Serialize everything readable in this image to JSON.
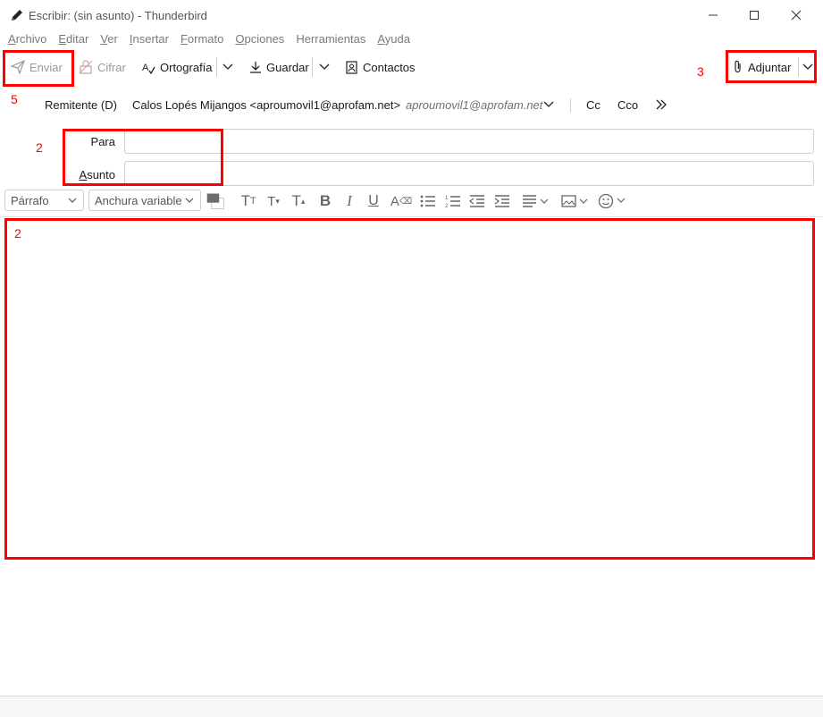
{
  "window": {
    "title": "Escribir: (sin asunto) - Thunderbird"
  },
  "menu": {
    "items": [
      {
        "label": "Archivo",
        "accel": "A",
        "rest": "rchivo"
      },
      {
        "label": "Editar",
        "accel": "E",
        "rest": "ditar"
      },
      {
        "label": "Ver",
        "accel": "V",
        "rest": "er"
      },
      {
        "label": "Insertar",
        "accel": "I",
        "rest": "nsertar"
      },
      {
        "label": "Formato",
        "accel": "F",
        "rest": "ormato"
      },
      {
        "label": "Opciones",
        "accel": "O",
        "rest": "pciones"
      },
      {
        "label": "Herramientas",
        "accel": "",
        "rest": "Herramientas"
      },
      {
        "label": "Ayuda",
        "accel": "A",
        "rest": "yuda"
      }
    ]
  },
  "toolbar": {
    "send_label": "Enviar",
    "encrypt_label": "Cifrar",
    "spelling_label": "Ortografía",
    "save_label": "Guardar",
    "contacts_label": "Contactos",
    "attach_label": "Adjuntar"
  },
  "header": {
    "from_label": "Remitente (D)",
    "from_value": "Calos Lopés Mijangos <aproumovil1@aprofam.net>",
    "from_identity": "aproumovil1@aprofam.net",
    "cc_label": "Cc",
    "bcc_label": "Cco",
    "more_label": "»",
    "to_label": "Para",
    "to_value": "",
    "subject_label": "Asunto",
    "subject_value": ""
  },
  "format": {
    "paragraph_select": "Párrafo",
    "font_select": "Anchura variable"
  },
  "annotations": {
    "send_marker": "5",
    "attach_marker": "3",
    "fields_marker": "2",
    "body_marker": "2",
    "color": "#ff0000"
  },
  "colors": {
    "accent": "#ff0000",
    "disabled_text": "#9a9a9a",
    "border": "#cfcfcf"
  }
}
